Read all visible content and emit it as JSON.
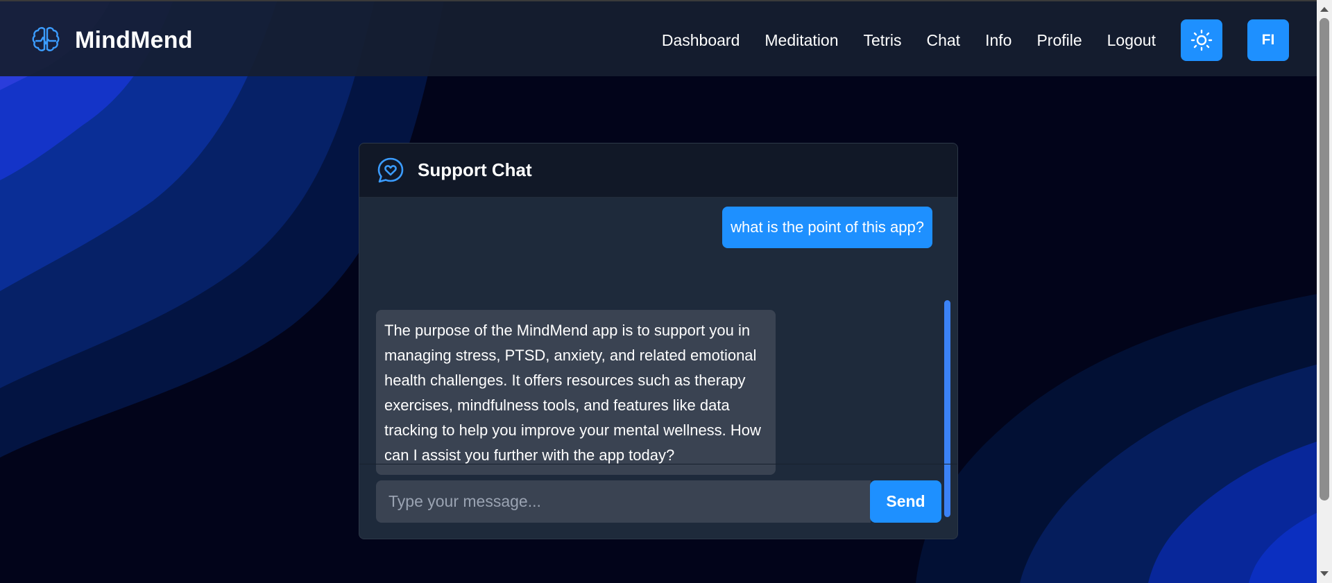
{
  "app": {
    "brand_name": "MindMend",
    "brand_icon": "brain-pulse-icon",
    "accent_color": "#1e90ff"
  },
  "nav": {
    "links": [
      "Dashboard",
      "Meditation",
      "Tetris",
      "Chat",
      "Info",
      "Profile",
      "Logout"
    ],
    "theme_toggle_icon": "sun-icon",
    "avatar_initials": "FI"
  },
  "chat": {
    "title": "Support Chat",
    "header_icon": "chat-heart-icon",
    "messages": [
      {
        "role": "user",
        "text": "what is the point of this app?"
      },
      {
        "role": "assistant",
        "text": "The purpose of the MindMend app is to support you in managing stress, PTSD, anxiety, and related emotional health challenges. It offers resources such as therapy exercises, mindfulness tools, and features like data tracking to help you improve your mental wellness. How can I assist you further with the app today?"
      }
    ],
    "input_placeholder": "Type your message...",
    "input_value": "",
    "send_label": "Send"
  }
}
